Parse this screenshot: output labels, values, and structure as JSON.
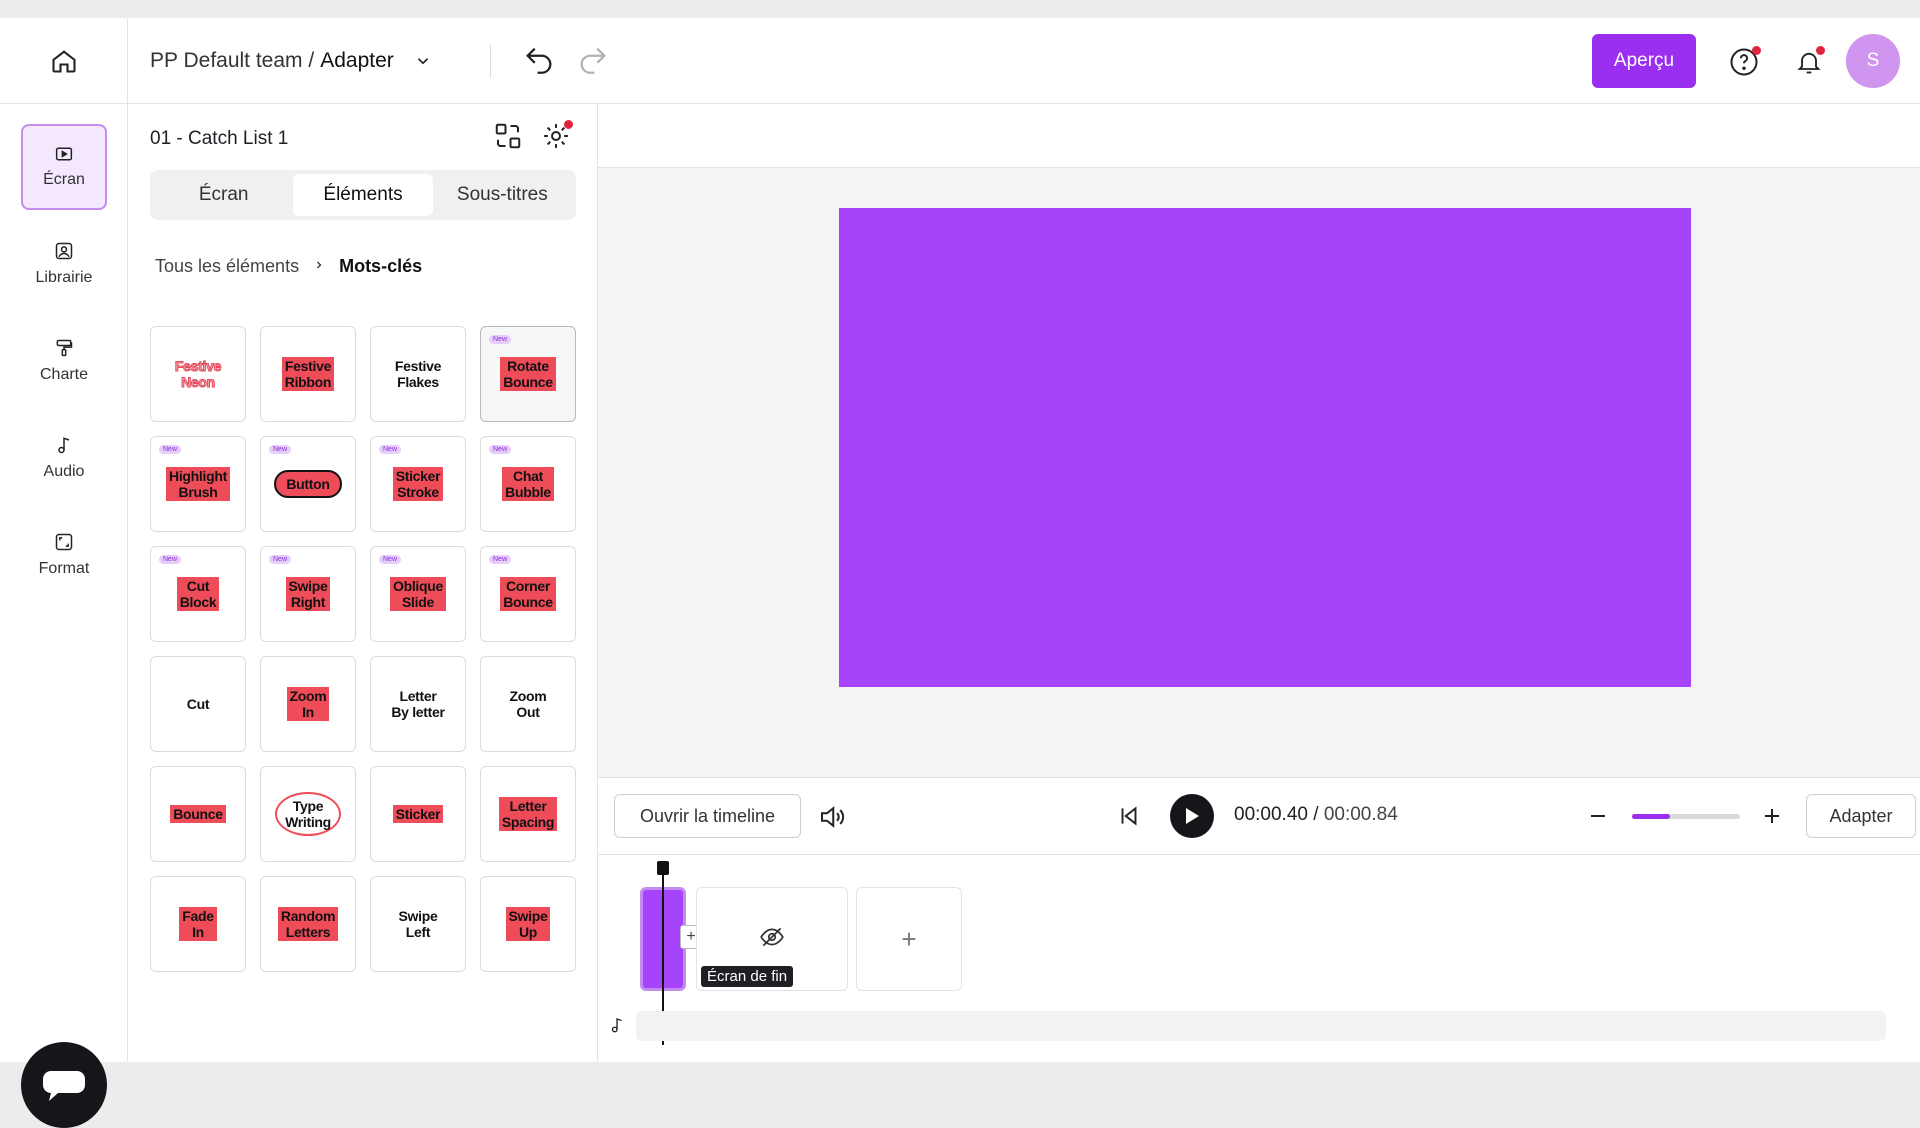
{
  "topbar": {
    "team": "PP Default team /",
    "project": "Adapter",
    "preview_label": "Aperçu",
    "avatar_initial": "S"
  },
  "sidenav": [
    {
      "label": "Écran",
      "icon": "screen-icon",
      "active": true
    },
    {
      "label": "Librairie",
      "icon": "library-icon",
      "active": false
    },
    {
      "label": "Charte",
      "icon": "paint-roller-icon",
      "active": false
    },
    {
      "label": "Audio",
      "icon": "music-note-icon",
      "active": false
    },
    {
      "label": "Format",
      "icon": "format-icon",
      "active": false
    }
  ],
  "panel": {
    "title": "01 - Catch List 1",
    "tabs": [
      "Écran",
      "Éléments",
      "Sous-titres"
    ],
    "active_tab": "Éléments",
    "breadcrumb": {
      "root": "Tous les éléments",
      "current": "Mots-clés"
    },
    "tiles": [
      {
        "label": "Festive\nNeon",
        "style": "neon",
        "new": false
      },
      {
        "label": "Festive\nRibbon",
        "style": "hl",
        "new": false
      },
      {
        "label": "Festive\nFlakes",
        "style": "plain",
        "new": false
      },
      {
        "label": "Rotate\nBounce",
        "style": "hl",
        "new": true
      },
      {
        "label": "Highlight\nBrush",
        "style": "hl",
        "new": true
      },
      {
        "label": "Button",
        "style": "pill",
        "new": true
      },
      {
        "label": "Sticker\nStroke",
        "style": "hl",
        "new": true
      },
      {
        "label": "Chat\nBubble",
        "style": "hl",
        "new": true
      },
      {
        "label": "Cut\nBlock",
        "style": "hl",
        "new": true
      },
      {
        "label": "Swipe\nRight",
        "style": "hl",
        "new": true
      },
      {
        "label": "Oblique\nSlide",
        "style": "hl",
        "new": true
      },
      {
        "label": "Corner\nBounce",
        "style": "hl",
        "new": true
      },
      {
        "label": "Cut",
        "style": "plain",
        "new": false
      },
      {
        "label": "Zoom\nIn",
        "style": "hl",
        "new": false
      },
      {
        "label": "Letter\nBy letter",
        "style": "plain",
        "new": false
      },
      {
        "label": "Zoom\nOut",
        "style": "plain",
        "new": false
      },
      {
        "label": "Bounce",
        "style": "hl",
        "new": false
      },
      {
        "label": "Type\nWriting",
        "style": "outline",
        "new": false
      },
      {
        "label": "Sticker",
        "style": "hl",
        "new": false
      },
      {
        "label": "Letter\nSpacing",
        "style": "hl",
        "new": false
      },
      {
        "label": "Fade\nIn",
        "style": "hl",
        "new": false
      },
      {
        "label": "Random\nLetters",
        "style": "hl",
        "new": false
      },
      {
        "label": "Swipe\nLeft",
        "style": "plain",
        "new": false
      },
      {
        "label": "Swipe\nUp",
        "style": "hl",
        "new": false
      }
    ],
    "new_badge": "New"
  },
  "player": {
    "open_timeline": "Ouvrir la timeline",
    "current_time": "00:00.40",
    "total_time": "00:00.84",
    "fit_label": "Adapter",
    "zoom_fraction": 0.35
  },
  "timeline": {
    "end_screen_label": "Écran de fin"
  },
  "colors": {
    "accent": "#9b2ff0",
    "video_bg": "#a644fb",
    "highlight": "#ef4c5a"
  }
}
